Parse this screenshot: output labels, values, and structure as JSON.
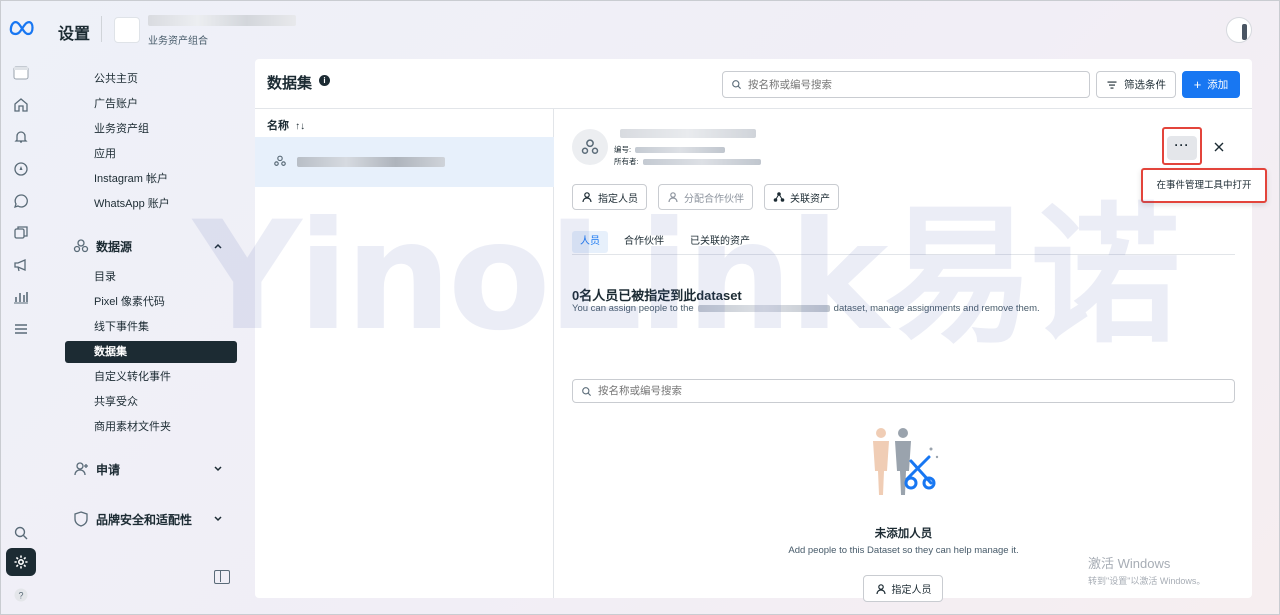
{
  "header": {
    "title": "设置",
    "account_subtitle": "业务资产组合"
  },
  "nav": {
    "top_items": [
      "公共主页",
      "广告账户",
      "业务资产组",
      "应用",
      "Instagram 帐户",
      "WhatsApp 账户"
    ],
    "datasource_section": "数据源",
    "datasource_items": [
      "目录",
      "Pixel 像素代码",
      "线下事件集"
    ],
    "active_item": "数据集",
    "datasource_items_after": [
      "自定义转化事件",
      "共享受众",
      "商用素材文件夹"
    ],
    "requests_section": "申请",
    "brand_safety_section": "品牌安全和适配性"
  },
  "main": {
    "title": "数据集",
    "search_placeholder": "按名称或编号搜索",
    "filter_label": "筛选条件",
    "add_label": "添加",
    "list_header": "名称",
    "sort_indicator": "↑↓"
  },
  "detail": {
    "id_label": "编号:",
    "owner_label": "所有者:",
    "more_label": "···",
    "menu_item": "在事件管理工具中打开",
    "actions": [
      "指定人员",
      "分配合作伙伴",
      "关联资产"
    ],
    "tabs": [
      "人员",
      "合作伙伴",
      "已关联的资产"
    ],
    "assigned_title": "0名人员已被指定到此dataset",
    "assigned_sub_prefix": "You can assign people to the",
    "assigned_sub_suffix": "dataset, manage assignments and remove them.",
    "people_search_placeholder": "按名称或编号搜索",
    "empty_title": "未添加人员",
    "empty_subtitle": "Add people to this Dataset so they can help manage it.",
    "empty_button": "指定人员"
  },
  "watermarks": {
    "brand": "YinoLink易诺",
    "windows_line1": "激活 Windows",
    "windows_line2": "转到\"设置\"以激活 Windows。"
  },
  "colors": {
    "accent": "#1877f2",
    "dark": "#1c2b33",
    "highlight": "#e3443b"
  }
}
